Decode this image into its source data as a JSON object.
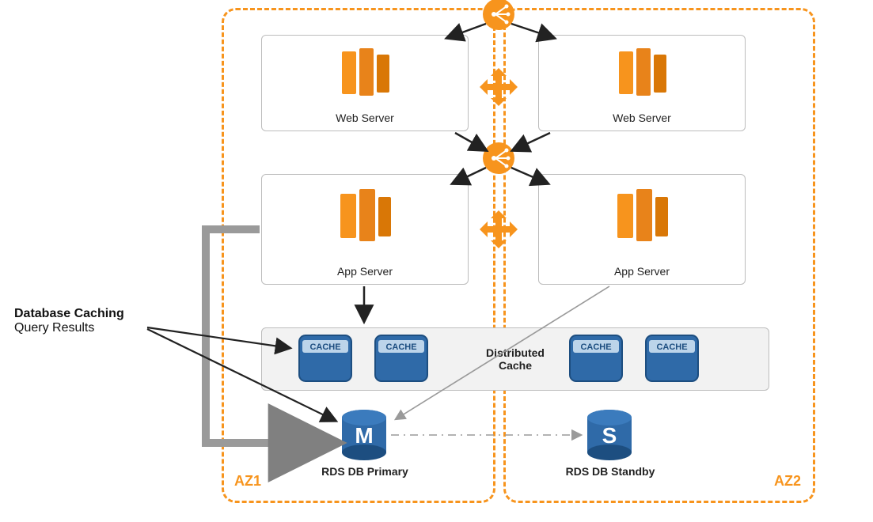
{
  "zones": {
    "az1": "AZ1",
    "az2": "AZ2"
  },
  "servers": {
    "web1": "Web Server",
    "web2": "Web Server",
    "app1": "App Server",
    "app2": "App Server"
  },
  "cache": {
    "label_line1": "Distributed",
    "label_line2": "Cache",
    "node_text": "CACHE"
  },
  "db": {
    "primary": "RDS DB Primary",
    "standby": "RDS DB Standby"
  },
  "annotation": {
    "line1": "Database Caching",
    "line2": "Query Results"
  }
}
